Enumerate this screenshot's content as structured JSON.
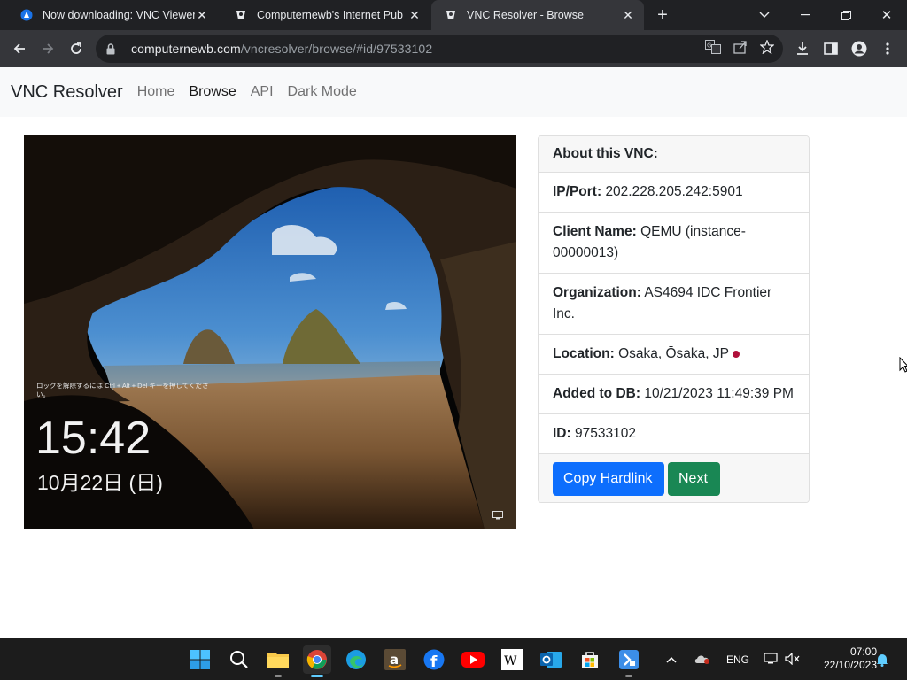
{
  "browser": {
    "tabs": [
      {
        "title": "Now downloading: VNC Viewer",
        "icon": "vnc-download-icon"
      },
      {
        "title": "Computernewb's Internet Pub H",
        "icon": "computernewb-icon"
      },
      {
        "title": "VNC Resolver - Browse",
        "icon": "computernewb-icon",
        "active": true
      }
    ],
    "url_domain": "computernewb.com",
    "url_path": "/vncresolver/browse/#id/97533102"
  },
  "site": {
    "brand": "VNC Resolver",
    "nav": [
      "Home",
      "Browse",
      "API",
      "Dark Mode"
    ],
    "active_nav": "Browse"
  },
  "screenshot": {
    "lock_hint": "ロックを解除するには Ctrl + Alt + Del キーを押してください。",
    "time": "15:42",
    "date": "10月22日 (日)"
  },
  "about": {
    "header": "About this VNC:",
    "fields": [
      {
        "label": "IP/Port:",
        "value": "202.228.205.242:5901"
      },
      {
        "label": "Client Name:",
        "value": "QEMU (instance-00000013)"
      },
      {
        "label": "Organization:",
        "value": "AS4694 IDC Frontier Inc."
      },
      {
        "label": "Location:",
        "value": "Osaka, Ōsaka, JP"
      },
      {
        "label": "Added to DB:",
        "value": "10/21/2023 11:49:39 PM"
      },
      {
        "label": "ID:",
        "value": "97533102"
      }
    ],
    "copy_button": "Copy Hardlink",
    "next_button": "Next"
  },
  "taskbar": {
    "language": "ENG",
    "time": "07:00",
    "date": "22/10/2023"
  },
  "colors": {
    "primary": "#0d6efd",
    "success": "#198754",
    "location_dot": "#b0103a"
  }
}
